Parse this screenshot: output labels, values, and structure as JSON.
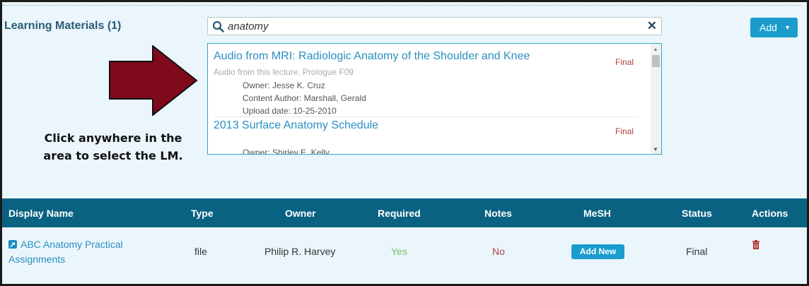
{
  "section": {
    "title": "Learning Materials (1)"
  },
  "search": {
    "value": "anatomy",
    "clear_glyph": "✕"
  },
  "add_button": {
    "label": "Add",
    "caret": "▼"
  },
  "results": [
    {
      "title": "Audio from MRI: Radiologic Anatomy of the Shoulder and Knee",
      "subtitle": "Audio from this lecture, Prologue F09",
      "owner": "Owner: Jesse K. Cruz",
      "author": "Content Author: Marshall, Gerald",
      "upload": "Upload date: 10-25-2010",
      "status": "Final"
    },
    {
      "title": "2013 Surface Anatomy Schedule",
      "owner": "Owner: Shirley E. Kelly",
      "status": "Final"
    }
  ],
  "callout": {
    "line1": "Click anywhere in the",
    "line2": "area to select the LM."
  },
  "table": {
    "headers": {
      "display_name": "Display Name",
      "type": "Type",
      "owner": "Owner",
      "required": "Required",
      "notes": "Notes",
      "mesh": "MeSH",
      "status": "Status",
      "actions": "Actions"
    },
    "rows": [
      {
        "name_line1": "ABC Anatomy Practical",
        "name_line2": "Assignments",
        "type": "file",
        "owner": "Philip R. Harvey",
        "required": "Yes",
        "notes": "No",
        "mesh_button": "Add New",
        "status": "Final"
      }
    ]
  },
  "colors": {
    "accent": "#1a9ccd",
    "header_bg": "#0a6282",
    "panel_bg": "#eaf6fc",
    "arrow": "#7e0a1c",
    "status_red": "#b04040",
    "yes_green": "#7cbc6a"
  },
  "icons": [
    "search-icon",
    "clear-icon",
    "caret-down-icon",
    "external-link-icon",
    "trash-icon",
    "arrow-right-icon"
  ]
}
